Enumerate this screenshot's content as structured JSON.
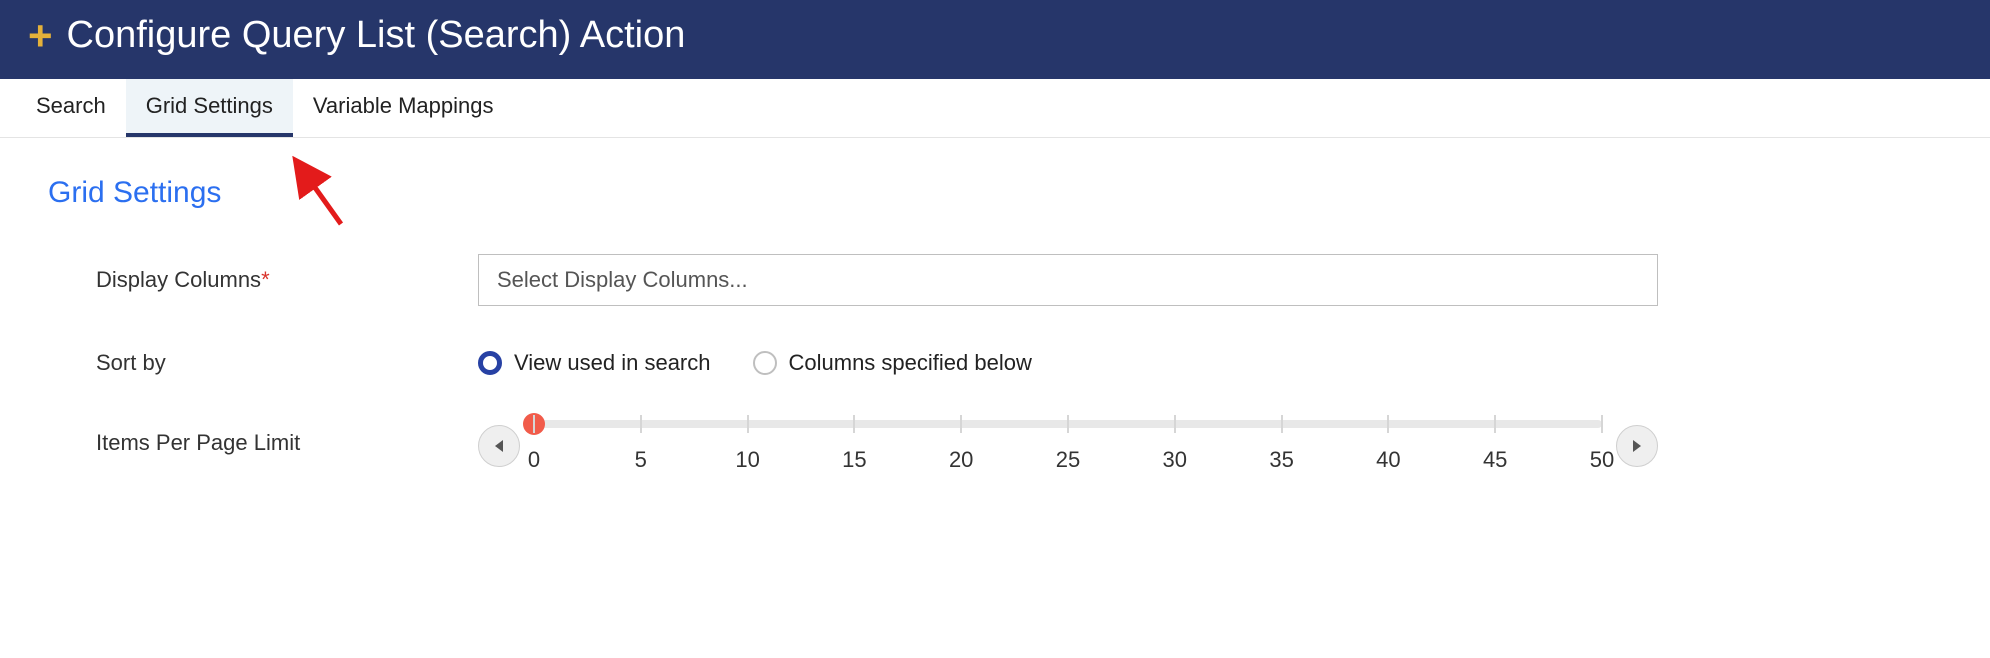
{
  "header": {
    "title": "Configure Query List (Search) Action"
  },
  "tabs": [
    {
      "label": "Search",
      "active": false
    },
    {
      "label": "Grid Settings",
      "active": true
    },
    {
      "label": "Variable Mappings",
      "active": false
    }
  ],
  "section": {
    "title": "Grid Settings"
  },
  "fields": {
    "display_columns_label": "Display Columns",
    "display_columns_required": "*",
    "display_columns_placeholder": "Select Display Columns...",
    "sort_by_label": "Sort by",
    "sort_options": {
      "view": "View used in search",
      "columns": "Columns specified below"
    },
    "sort_selected": "view",
    "items_per_page_label": "Items Per Page Limit",
    "slider": {
      "min": 0,
      "max": 50,
      "value": 0,
      "ticks": [
        0,
        5,
        10,
        15,
        20,
        25,
        30,
        35,
        40,
        45,
        50
      ]
    }
  }
}
